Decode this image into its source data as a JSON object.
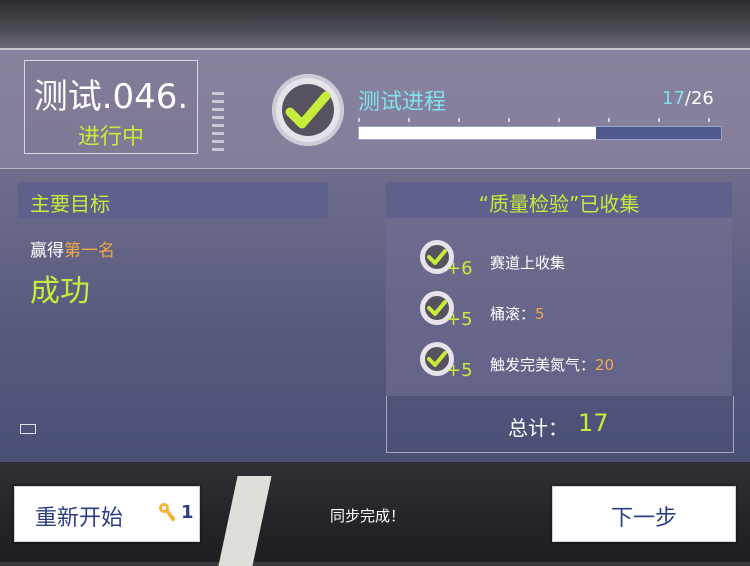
{
  "header": {
    "test_id": "测试.046.",
    "test_status": "进行中",
    "progress_title": "测试进程",
    "progress_current": "17",
    "progress_total": "/26",
    "progress_fraction": 0.654
  },
  "main_goal": {
    "heading": "主要目标",
    "objective_prefix": "赢得",
    "objective_highlight": "第一名",
    "result": "成功"
  },
  "bonus": {
    "heading": "“质量检验”已收集",
    "items": [
      {
        "points": "+6",
        "label": "赛道上收集",
        "value": ""
      },
      {
        "points": "+5",
        "label": "桶滚：",
        "value": "5"
      },
      {
        "points": "+5",
        "label": "触发完美氮气：",
        "value": "20"
      }
    ],
    "total_label": "总计：",
    "total_value": "17"
  },
  "footer": {
    "restart_label": "重新开始",
    "restart_key_count": "1",
    "sync_text": "同步完成！",
    "next_label": "下一步"
  },
  "colors": {
    "accent_green": "#c6ec3c",
    "accent_cyan": "#7fe3ee",
    "accent_orange": "#f3a64a",
    "button_text": "#2c3e86"
  },
  "icons": [
    "check-icon",
    "key-icon"
  ]
}
